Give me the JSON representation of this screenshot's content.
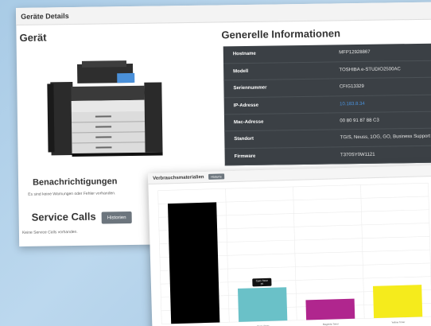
{
  "panel": {
    "title": "Geräte Details"
  },
  "device": {
    "heading": "Gerät"
  },
  "info": {
    "heading": "Generelle Informationen",
    "rows": [
      {
        "key": "Hostname",
        "value": "MFP12928867"
      },
      {
        "key": "Modell",
        "value": "TOSHIBA e-STUDIO2500AC"
      },
      {
        "key": "Seriennummer",
        "value": "CFIG13329"
      },
      {
        "key": "IP-Adresse",
        "value": "10.183.8.34",
        "link": true
      },
      {
        "key": "Mac-Adresse",
        "value": "00 80 91 87 88 C3"
      },
      {
        "key": "Standort",
        "value": "TGIS, Neuss, 1OG, GO, Business Support"
      },
      {
        "key": "Firmware",
        "value": "T370SY0W1121"
      }
    ]
  },
  "notifications": {
    "heading": "Benachrichtigungen",
    "text": "Es sind keine Warnungen oder Fehler vorhanden."
  },
  "service_calls": {
    "heading": "Service Calls",
    "button": "Historien",
    "text": "Keine Service Calls vorhanden."
  },
  "consumables": {
    "heading": "Verbrauchsmaterialien",
    "button": "Historie"
  },
  "chart_data": {
    "type": "bar",
    "categories": [
      "Black Toner",
      "Cyan Toner",
      "Magenta Toner",
      "Yellow Toner"
    ],
    "values": [
      90,
      25,
      15,
      24
    ],
    "colors": [
      "#000000",
      "#6ac1c8",
      "#b0268e",
      "#f5eb1c"
    ],
    "ylim": [
      0,
      100
    ],
    "tooltip": {
      "category": "Cyan Toner",
      "label": "Cyan Toner",
      "value": "25"
    },
    "grid": true
  }
}
